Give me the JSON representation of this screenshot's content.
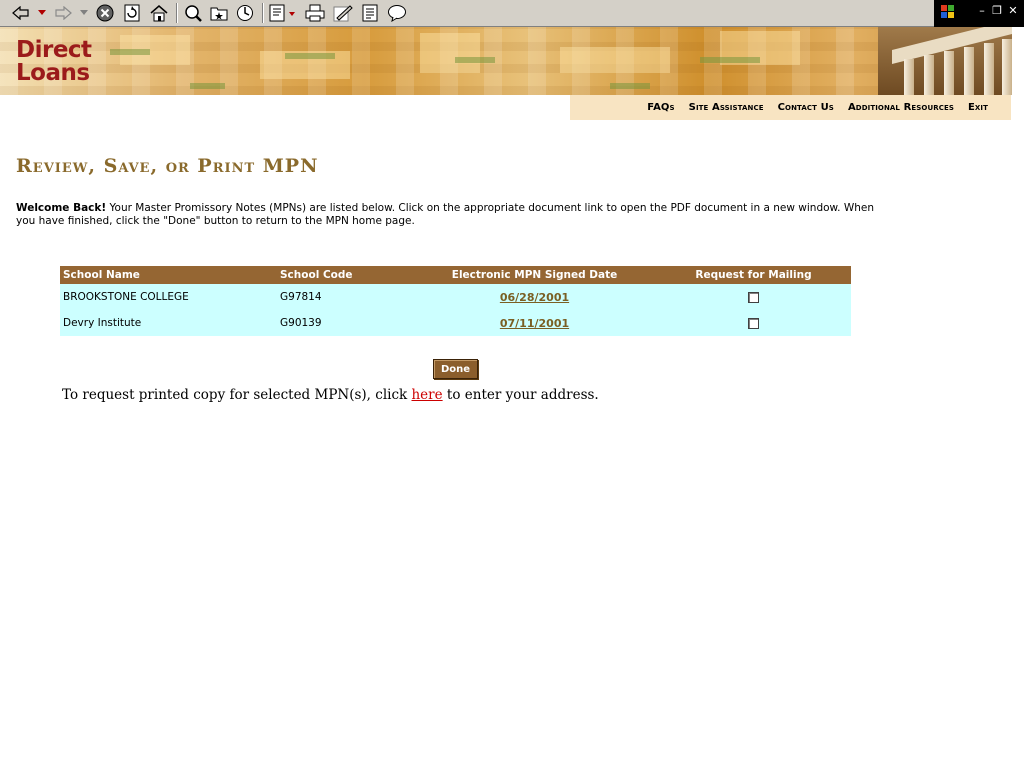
{
  "browser": {
    "toolbar_icons": [
      "back-icon",
      "back-dropdown-icon",
      "forward-icon",
      "forward-dropdown-icon",
      "stop-icon",
      "refresh-icon",
      "home-icon",
      "search-icon",
      "favorites-icon",
      "history-icon",
      "mail-icon",
      "print-icon",
      "edit-icon",
      "discuss-icon",
      "messenger-icon"
    ]
  },
  "banner": {
    "logo_line1": "Direct",
    "logo_line2": "Loans"
  },
  "nav": {
    "faqs": "FAQs",
    "site_assistance": "Site Assistance",
    "contact_us": "Contact Us",
    "additional_resources": "Additional Resources",
    "exit": "Exit"
  },
  "page": {
    "title": "Review, Save, or Print MPN",
    "intro_bold": "Welcome Back!",
    "intro_text": " Your Master Promissory Notes (MPNs) are listed below. Click on the appropriate document link to open the PDF document in a new window. When you have finished, click the \"Done\" button to return to the MPN home page."
  },
  "table": {
    "headers": [
      "School Name",
      "School Code",
      "Electronic MPN Signed Date",
      "Request for Mailing"
    ],
    "rows": [
      {
        "school_name": "BROOKSTONE COLLEGE",
        "school_code": "G97814",
        "signed_date": "06/28/2001",
        "mailing": false
      },
      {
        "school_name": "Devry Institute",
        "school_code": "G90139",
        "signed_date": "07/11/2001",
        "mailing": false
      }
    ]
  },
  "actions": {
    "done_label": "Done",
    "request_before": "To request printed copy for selected MPN(s), click ",
    "request_link": "here",
    "request_after": " to enter your address."
  },
  "colors": {
    "header_bg": "#956633",
    "row_bg": "#ccffff",
    "title": "#8a6a2c",
    "logo": "#9b1b1b",
    "nav_bg": "#f8e4c2"
  }
}
